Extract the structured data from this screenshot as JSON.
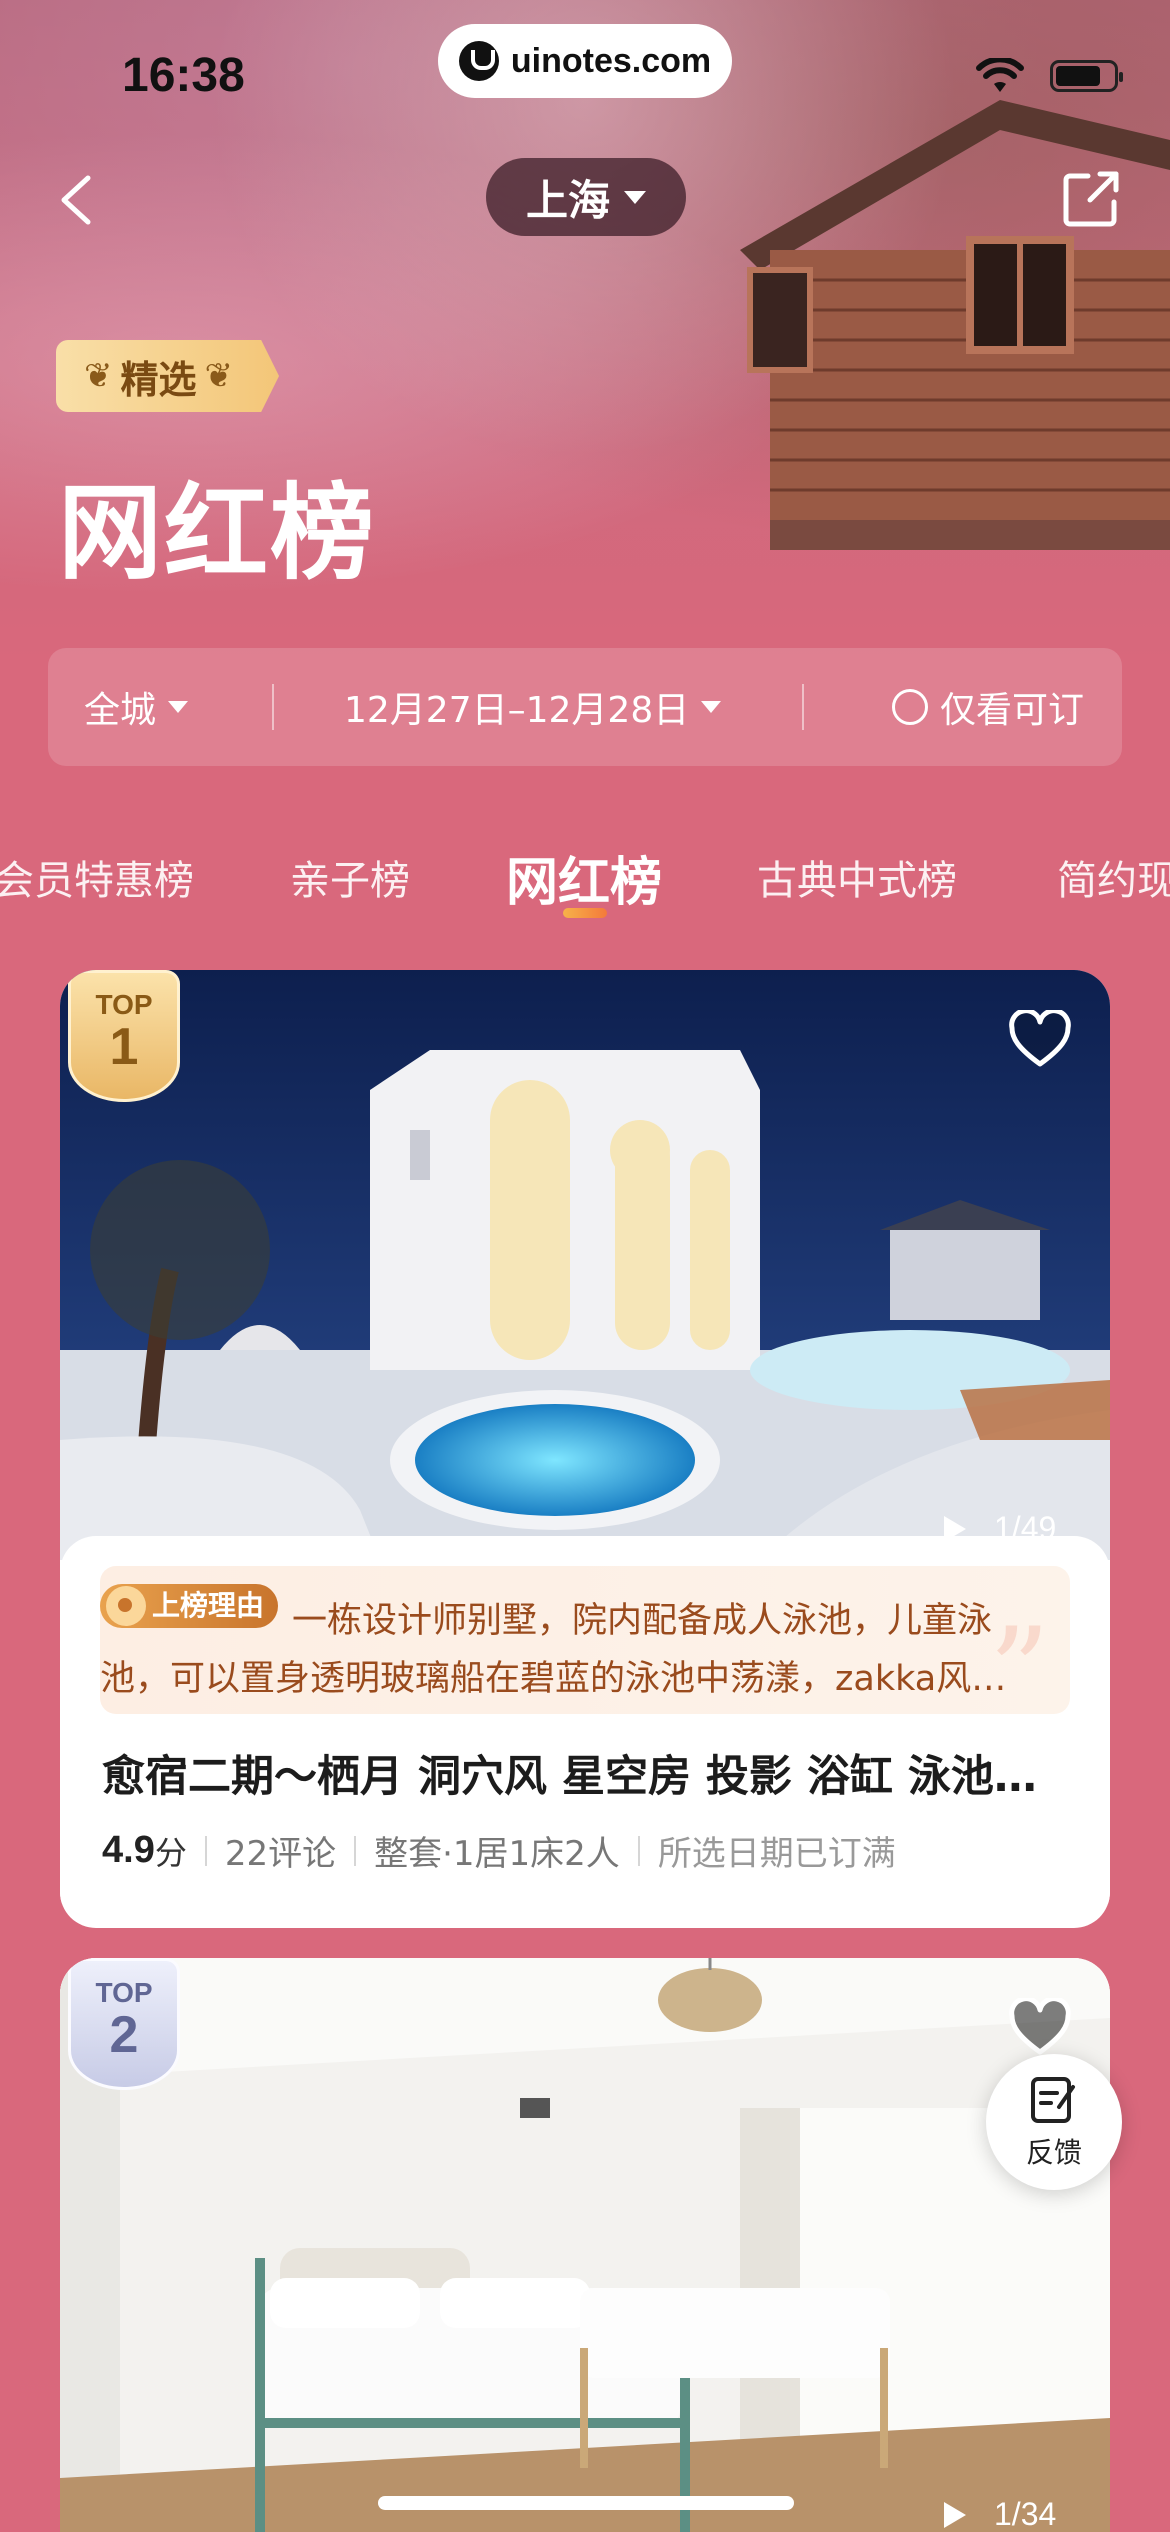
{
  "status_bar": {
    "time": "16:38",
    "url": "uinotes.com"
  },
  "nav": {
    "city": "上海",
    "back_icon": "chevron-left-icon",
    "share_icon": "share-icon"
  },
  "hero": {
    "badge_label": "精选",
    "title": "网红榜"
  },
  "filter": {
    "city": "全城",
    "date_range": "12月27日–12月28日",
    "available_only": "仅看可订"
  },
  "tabs": [
    {
      "label": "会员特惠榜"
    },
    {
      "label": "亲子榜"
    },
    {
      "label": "网红榜",
      "active": true
    },
    {
      "label": "古典中式榜"
    },
    {
      "label": "简约现"
    }
  ],
  "listings": [
    {
      "rank_top": "TOP",
      "rank": "1",
      "photo_count": "1/49",
      "reason_tag": "上榜理由",
      "reason_line1": "一栋设计师别墅，院内配备成人泳池，儿童泳",
      "reason_line2": "池，可以置身透明玻璃船在碧蓝的泳池中荡漾，zakka风格的装修",
      "title": "愈宿二期～栖月 洞穴风 星空房 投影 浴缸 泳池别墅",
      "score": "4.9",
      "score_unit": "分",
      "reviews": "22评论",
      "room_type": "整套·1居1床2人",
      "availability": "所选日期已订满"
    },
    {
      "rank_top": "TOP",
      "rank": "2",
      "photo_count": "1/34"
    }
  ],
  "feedback": {
    "label": "反馈"
  },
  "colors": {
    "page_bg": "#d9687c",
    "accent_gold": "#f3c678",
    "reason_text": "#9a4b1d",
    "tab_indicator": "#f47a3a"
  }
}
